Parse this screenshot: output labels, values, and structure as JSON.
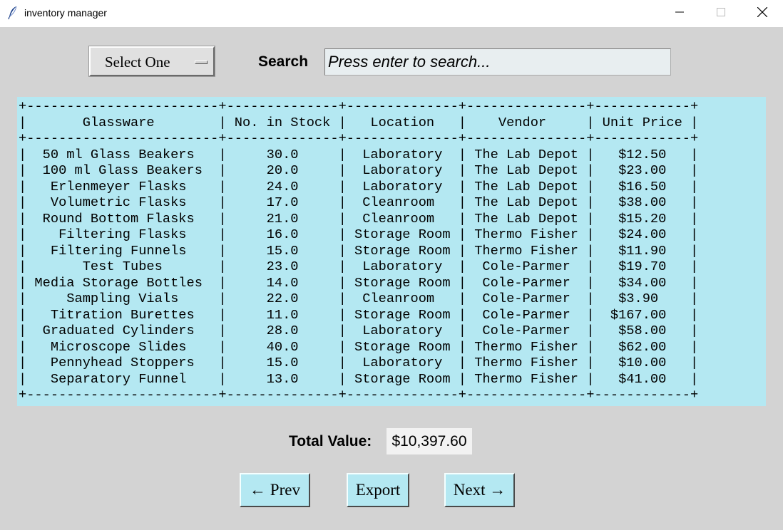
{
  "window": {
    "title": "inventory manager"
  },
  "toolbar": {
    "select_label": "Select One",
    "search_label": "Search",
    "search_placeholder": "Press enter to search..."
  },
  "table": {
    "columns": [
      {
        "name": "Glassware",
        "width": 24
      },
      {
        "name": "No. in Stock",
        "width": 14
      },
      {
        "name": "Location",
        "width": 14
      },
      {
        "name": "Vendor",
        "width": 15
      },
      {
        "name": "Unit Price",
        "width": 12
      }
    ],
    "rows": [
      [
        "50 ml Glass Beakers",
        "30.0",
        "Laboratory",
        "The Lab Depot",
        "$12.50"
      ],
      [
        "100 ml Glass Beakers",
        "20.0",
        "Laboratory",
        "The Lab Depot",
        "$23.00"
      ],
      [
        "Erlenmeyer Flasks",
        "24.0",
        "Laboratory",
        "The Lab Depot",
        "$16.50"
      ],
      [
        "Volumetric Flasks",
        "17.0",
        "Cleanroom",
        "The Lab Depot",
        "$38.00"
      ],
      [
        "Round Bottom Flasks",
        "21.0",
        "Cleanroom",
        "The Lab Depot",
        "$15.20"
      ],
      [
        "Filtering Flasks",
        "16.0",
        "Storage Room",
        "Thermo Fisher",
        "$24.00"
      ],
      [
        "Filtering Funnels",
        "15.0",
        "Storage Room",
        "Thermo Fisher",
        "$11.90"
      ],
      [
        "Test Tubes",
        "23.0",
        "Laboratory",
        "Cole-Parmer",
        "$19.70"
      ],
      [
        "Media Storage Bottles",
        "14.0",
        "Storage Room",
        "Cole-Parmer",
        "$34.00"
      ],
      [
        "Sampling Vials",
        "22.0",
        "Cleanroom",
        "Cole-Parmer",
        "$3.90"
      ],
      [
        "Titration Burettes",
        "11.0",
        "Storage Room",
        "Cole-Parmer",
        "$167.00"
      ],
      [
        "Graduated Cylinders",
        "28.0",
        "Laboratory",
        "Cole-Parmer",
        "$58.00"
      ],
      [
        "Microscope Slides",
        "40.0",
        "Storage Room",
        "Thermo Fisher",
        "$62.00"
      ],
      [
        "Pennyhead Stoppers",
        "15.0",
        "Laboratory",
        "Thermo Fisher",
        "$10.00"
      ],
      [
        "Separatory Funnel",
        "13.0",
        "Storage Room",
        "Thermo Fisher",
        "$41.00"
      ]
    ]
  },
  "summary": {
    "total_label": "Total Value:",
    "total_value": "$10,397.60"
  },
  "buttons": {
    "prev": "← Prev",
    "export": "Export",
    "next": "Next →"
  },
  "icons": {
    "app": "feather-icon",
    "minimize": "minimize-icon",
    "maximize": "maximize-icon",
    "close": "close-icon"
  },
  "colors": {
    "table_bg": "#b4e8f2",
    "window_bg": "#d3d3d3",
    "button_bg": "#b4e8f2"
  }
}
